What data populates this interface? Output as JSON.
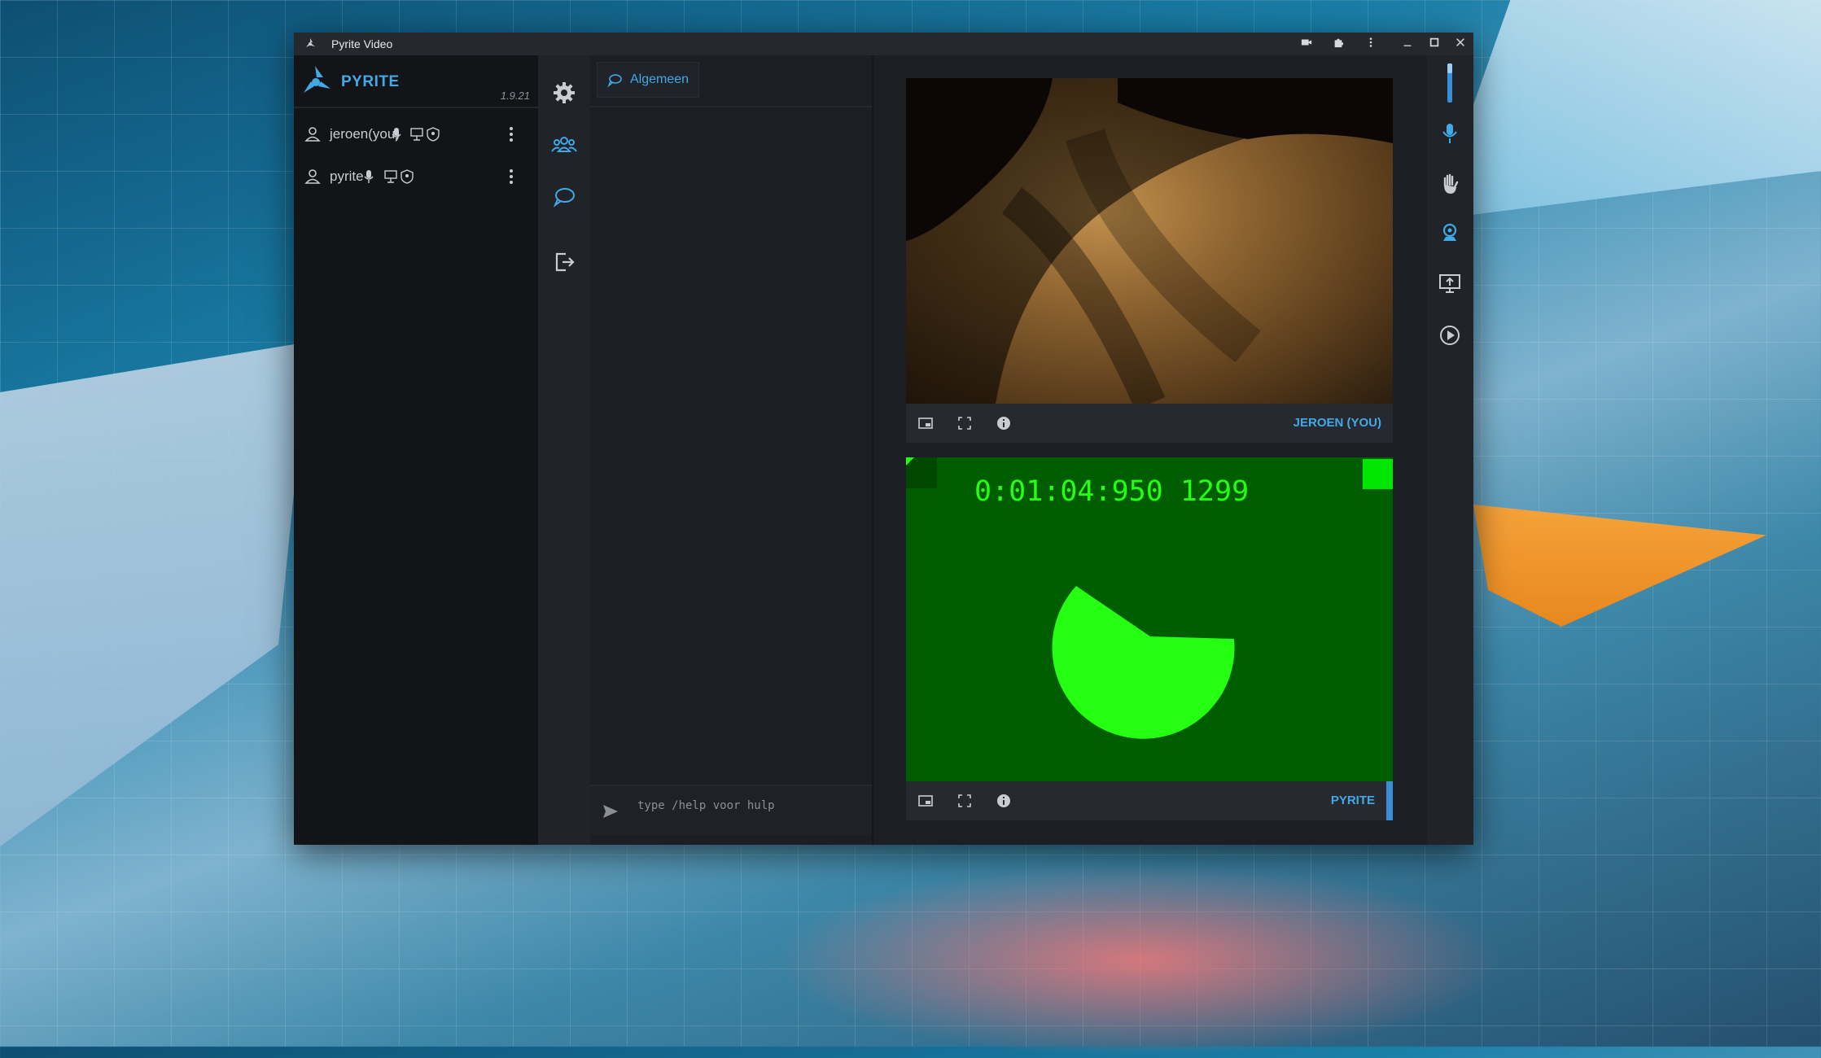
{
  "window": {
    "title": "Pyrite Video"
  },
  "sidebar": {
    "brand": "PYRITE",
    "version": "1.9.21",
    "users": [
      {
        "name": "jeroen(you)"
      },
      {
        "name": "pyrite"
      }
    ]
  },
  "chat": {
    "channel_tab": "Algemeen",
    "input_placeholder": "type /help voor hulp"
  },
  "videos": [
    {
      "label": "JEROEN (YOU)"
    },
    {
      "label": "PYRITE",
      "timer_text": "0:01:04:950 1299"
    }
  ],
  "colors": {
    "accent": "#42a9e6",
    "test_green": "#24ff12",
    "test_bg": "#005d00"
  }
}
